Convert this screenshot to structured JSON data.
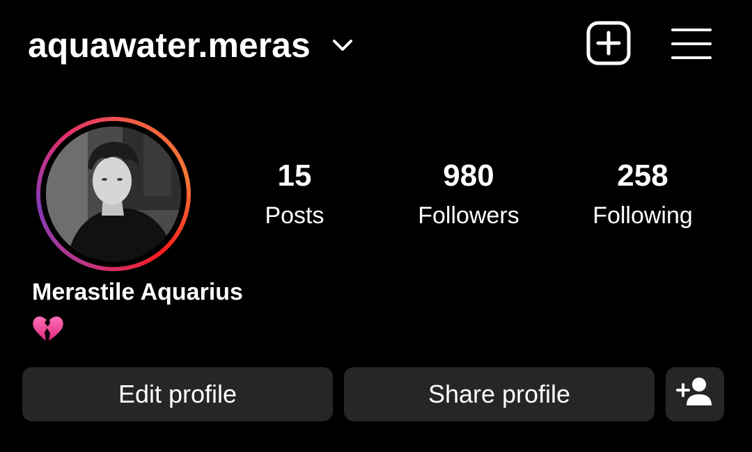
{
  "header": {
    "username": "aquawater.meras",
    "chevron_icon": "chevron-down-icon",
    "create_icon": "plus-square-icon",
    "menu_icon": "hamburger-menu-icon"
  },
  "profile": {
    "display_name": "Merastile Aquarius",
    "bio_emoji": "💔",
    "avatar_ring_colors": [
      "#c13584",
      "#e1306c",
      "#f77737"
    ]
  },
  "stats": [
    {
      "value": "15",
      "label": "Posts"
    },
    {
      "value": "980",
      "label": "Followers"
    },
    {
      "value": "258",
      "label": "Following"
    }
  ],
  "actions": {
    "edit_label": "Edit profile",
    "share_label": "Share profile",
    "add_icon": "add-person-icon"
  },
  "colors": {
    "background": "#000000",
    "button_bg": "#262626",
    "text": "#ffffff"
  }
}
